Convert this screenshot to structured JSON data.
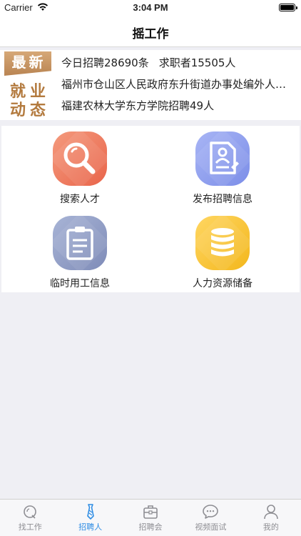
{
  "status_bar": {
    "carrier": "Carrier",
    "time": "3:04 PM"
  },
  "nav": {
    "title": "摇工作"
  },
  "news": {
    "badge": {
      "top": "最新",
      "line1": "就业",
      "line2": "动态"
    },
    "stats": {
      "jobs_today": "今日招聘28690条",
      "seekers": "求职者15505人"
    },
    "items": [
      "福州市仓山区人民政府东升街道办事处编外人员招聘",
      "福建农林大学东方学院招聘49人"
    ]
  },
  "features": [
    {
      "label": "搜索人才",
      "icon": "search-icon",
      "color": "#ee7556"
    },
    {
      "label": "发布招聘信息",
      "icon": "resume-document-icon",
      "color": "#8a9bec"
    },
    {
      "label": "临时用工信息",
      "icon": "clipboard-icon",
      "color": "#8c98c4"
    },
    {
      "label": "人力资源储备",
      "icon": "database-icon",
      "color": "#f6c53a"
    }
  ],
  "tabs": [
    {
      "label": "找工作",
      "icon": "search-tab-icon",
      "active": false
    },
    {
      "label": "招聘人",
      "icon": "tie-icon",
      "active": true
    },
    {
      "label": "招聘会",
      "icon": "briefcase-icon",
      "active": false
    },
    {
      "label": "视频面试",
      "icon": "chat-bubble-icon",
      "active": false
    },
    {
      "label": "我的",
      "icon": "person-icon",
      "active": false
    }
  ],
  "colors": {
    "accent": "#2f8de4",
    "badge_brown": "#b37a3e",
    "background": "#efeff4"
  }
}
